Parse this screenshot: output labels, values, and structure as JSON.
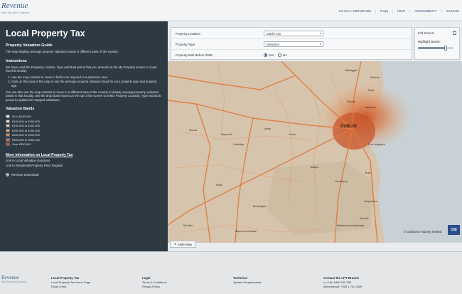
{
  "header": {
    "brand": "Revenue",
    "brand_sub": "Irish Tax and Customs",
    "links": [
      "LO CALL: 1890 200 255",
      "FAQS",
      "HELP",
      "ACCESSIBILITY",
      "GAEILGE"
    ]
  },
  "left_panel": {
    "title": "Local Property Tax",
    "subtitle": "Property Valuation Guide",
    "intro": "The map displays average property valuation bands in different parts of the country.",
    "instructions_heading": "Instructions",
    "instructions_text": "We have used the Property Location, Type and Built period that you entered on the My Property screen to zoom into this locality.",
    "steps": [
      "Use the map controls to zoom in further as required to a particular area.",
      "Click on this area of the map to see the average property valuation band for your property type and property age."
    ],
    "extra_text": "You can also use the map controls to move to a different area of the country to display average property valuation bands in that locality. Use the drop-down boxes on the top of the screen to select Property Location, Type and Built period to update the mapped valuations.",
    "bands_heading": "Valuation Bands",
    "bands": [
      {
        "label": "€0 to €100,000",
        "color": "#efe6da"
      },
      {
        "label": "€100,000 to €150,000",
        "color": "#f1d9c0"
      },
      {
        "label": "€150,000 to €200,000",
        "color": "#eec39c"
      },
      {
        "label": "€200,000 to €250,000",
        "color": "#e9a877"
      },
      {
        "label": "€250,000 to €300,000",
        "color": "#e08b56"
      },
      {
        "label": "€300,000 to €350,000",
        "color": "#d46f3b"
      },
      {
        "label": "Over €350,000",
        "color": "#b9502a"
      }
    ],
    "more_info": "More information on Local Property Tax",
    "link_1": "Link to Local Valuation Guidance",
    "link_2": "Link to Residential Property Price Register",
    "downloads": "Revenue Downloads"
  },
  "form": {
    "location_label": "Property Location:",
    "location_value": "Dublin City",
    "type_label": "Property Type:",
    "type_value": "Detached",
    "built_label": "Property Built Before 2006:",
    "yes_label": "Yes",
    "no_label": "No",
    "built_selected": "yes"
  },
  "side_panel": {
    "fullscreen_label": "Full Screen:",
    "highlight_label": "Highlight Bands:",
    "highlight_level": 0.78
  },
  "map": {
    "city_label": "DUBLIN",
    "places": [
      "Balbriggan",
      "Skerries",
      "Rush",
      "Malahide",
      "Swords",
      "Kilcock",
      "Maynooth",
      "Celbridge",
      "Lucan",
      "Leixlip",
      "Tallaght",
      "Dun Laoghaire",
      "Bray",
      "Greystones",
      "Naas",
      "Blessington",
      "Enniskerry",
      "Kilcullen",
      "Ballymore Eustace",
      "Kilcoole",
      "Newtownmountkennedy"
    ],
    "hide_map_label": "Hide Map",
    "attribution": "© Ordnance Survey Ireland",
    "osi_logo": "OSi",
    "colors": {
      "land": "#d9c6ae",
      "sea": "#c9d3d8",
      "road": "#e07a3c",
      "urban": "#d86a32"
    }
  },
  "footer": {
    "brand": "Revenue",
    "brand_sub": "Irish Tax and Customs",
    "col1_head": "Local Property Tax",
    "col1_items": [
      "Local Property Tax Home Page",
      "FAQs | Help"
    ],
    "col2_head": "Legal",
    "col2_items": [
      "Terms & Conditions",
      "Privacy Policy"
    ],
    "col3_head": "Technical",
    "col3_items": [
      "System Requirements"
    ],
    "col4_head": "Contact the LPT Branch",
    "col4_items": [
      "Lo Call: 1890 200 255",
      "International: +353 1 702 3049"
    ]
  }
}
